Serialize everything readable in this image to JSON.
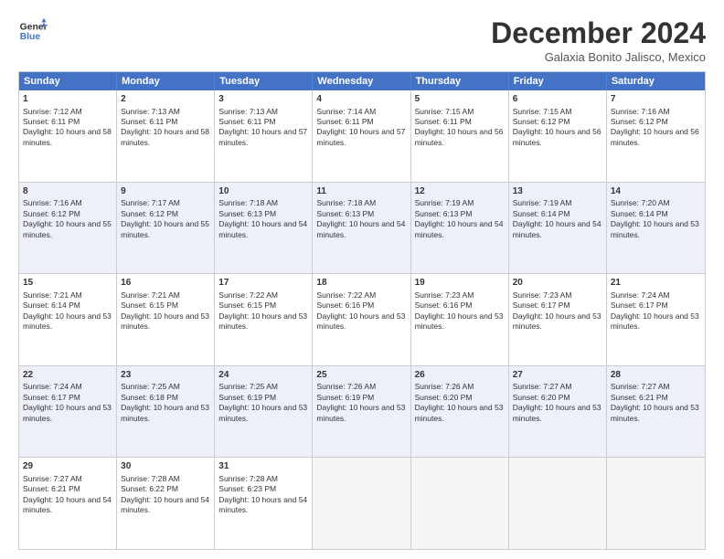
{
  "header": {
    "logo_line1": "General",
    "logo_line2": "Blue",
    "month_title": "December 2024",
    "location": "Galaxia Bonito Jalisco, Mexico"
  },
  "calendar": {
    "days_of_week": [
      "Sunday",
      "Monday",
      "Tuesday",
      "Wednesday",
      "Thursday",
      "Friday",
      "Saturday"
    ],
    "weeks": [
      [
        {
          "day": "",
          "empty": true
        },
        {
          "day": "",
          "empty": true
        },
        {
          "day": "",
          "empty": true
        },
        {
          "day": "",
          "empty": true
        },
        {
          "day": "",
          "empty": true
        },
        {
          "day": "",
          "empty": true
        },
        {
          "day": "1",
          "rise": "Sunrise: 7:16 AM",
          "set": "Sunset: 6:12 PM",
          "daylight": "Daylight: 10 hours and 56 minutes."
        }
      ],
      [
        {
          "day": "1",
          "rise": "Sunrise: 7:12 AM",
          "set": "Sunset: 6:11 PM",
          "daylight": "Daylight: 10 hours and 58 minutes."
        },
        {
          "day": "2",
          "rise": "Sunrise: 7:13 AM",
          "set": "Sunset: 6:11 PM",
          "daylight": "Daylight: 10 hours and 58 minutes."
        },
        {
          "day": "3",
          "rise": "Sunrise: 7:13 AM",
          "set": "Sunset: 6:11 PM",
          "daylight": "Daylight: 10 hours and 57 minutes."
        },
        {
          "day": "4",
          "rise": "Sunrise: 7:14 AM",
          "set": "Sunset: 6:11 PM",
          "daylight": "Daylight: 10 hours and 57 minutes."
        },
        {
          "day": "5",
          "rise": "Sunrise: 7:15 AM",
          "set": "Sunset: 6:11 PM",
          "daylight": "Daylight: 10 hours and 56 minutes."
        },
        {
          "day": "6",
          "rise": "Sunrise: 7:15 AM",
          "set": "Sunset: 6:12 PM",
          "daylight": "Daylight: 10 hours and 56 minutes."
        },
        {
          "day": "7",
          "rise": "Sunrise: 7:16 AM",
          "set": "Sunset: 6:12 PM",
          "daylight": "Daylight: 10 hours and 56 minutes."
        }
      ],
      [
        {
          "day": "8",
          "rise": "Sunrise: 7:16 AM",
          "set": "Sunset: 6:12 PM",
          "daylight": "Daylight: 10 hours and 55 minutes."
        },
        {
          "day": "9",
          "rise": "Sunrise: 7:17 AM",
          "set": "Sunset: 6:12 PM",
          "daylight": "Daylight: 10 hours and 55 minutes."
        },
        {
          "day": "10",
          "rise": "Sunrise: 7:18 AM",
          "set": "Sunset: 6:13 PM",
          "daylight": "Daylight: 10 hours and 54 minutes."
        },
        {
          "day": "11",
          "rise": "Sunrise: 7:18 AM",
          "set": "Sunset: 6:13 PM",
          "daylight": "Daylight: 10 hours and 54 minutes."
        },
        {
          "day": "12",
          "rise": "Sunrise: 7:19 AM",
          "set": "Sunset: 6:13 PM",
          "daylight": "Daylight: 10 hours and 54 minutes."
        },
        {
          "day": "13",
          "rise": "Sunrise: 7:19 AM",
          "set": "Sunset: 6:14 PM",
          "daylight": "Daylight: 10 hours and 54 minutes."
        },
        {
          "day": "14",
          "rise": "Sunrise: 7:20 AM",
          "set": "Sunset: 6:14 PM",
          "daylight": "Daylight: 10 hours and 53 minutes."
        }
      ],
      [
        {
          "day": "15",
          "rise": "Sunrise: 7:21 AM",
          "set": "Sunset: 6:14 PM",
          "daylight": "Daylight: 10 hours and 53 minutes."
        },
        {
          "day": "16",
          "rise": "Sunrise: 7:21 AM",
          "set": "Sunset: 6:15 PM",
          "daylight": "Daylight: 10 hours and 53 minutes."
        },
        {
          "day": "17",
          "rise": "Sunrise: 7:22 AM",
          "set": "Sunset: 6:15 PM",
          "daylight": "Daylight: 10 hours and 53 minutes."
        },
        {
          "day": "18",
          "rise": "Sunrise: 7:22 AM",
          "set": "Sunset: 6:16 PM",
          "daylight": "Daylight: 10 hours and 53 minutes."
        },
        {
          "day": "19",
          "rise": "Sunrise: 7:23 AM",
          "set": "Sunset: 6:16 PM",
          "daylight": "Daylight: 10 hours and 53 minutes."
        },
        {
          "day": "20",
          "rise": "Sunrise: 7:23 AM",
          "set": "Sunset: 6:17 PM",
          "daylight": "Daylight: 10 hours and 53 minutes."
        },
        {
          "day": "21",
          "rise": "Sunrise: 7:24 AM",
          "set": "Sunset: 6:17 PM",
          "daylight": "Daylight: 10 hours and 53 minutes."
        }
      ],
      [
        {
          "day": "22",
          "rise": "Sunrise: 7:24 AM",
          "set": "Sunset: 6:17 PM",
          "daylight": "Daylight: 10 hours and 53 minutes."
        },
        {
          "day": "23",
          "rise": "Sunrise: 7:25 AM",
          "set": "Sunset: 6:18 PM",
          "daylight": "Daylight: 10 hours and 53 minutes."
        },
        {
          "day": "24",
          "rise": "Sunrise: 7:25 AM",
          "set": "Sunset: 6:19 PM",
          "daylight": "Daylight: 10 hours and 53 minutes."
        },
        {
          "day": "25",
          "rise": "Sunrise: 7:26 AM",
          "set": "Sunset: 6:19 PM",
          "daylight": "Daylight: 10 hours and 53 minutes."
        },
        {
          "day": "26",
          "rise": "Sunrise: 7:26 AM",
          "set": "Sunset: 6:20 PM",
          "daylight": "Daylight: 10 hours and 53 minutes."
        },
        {
          "day": "27",
          "rise": "Sunrise: 7:27 AM",
          "set": "Sunset: 6:20 PM",
          "daylight": "Daylight: 10 hours and 53 minutes."
        },
        {
          "day": "28",
          "rise": "Sunrise: 7:27 AM",
          "set": "Sunset: 6:21 PM",
          "daylight": "Daylight: 10 hours and 53 minutes."
        }
      ],
      [
        {
          "day": "29",
          "rise": "Sunrise: 7:27 AM",
          "set": "Sunset: 6:21 PM",
          "daylight": "Daylight: 10 hours and 54 minutes."
        },
        {
          "day": "30",
          "rise": "Sunrise: 7:28 AM",
          "set": "Sunset: 6:22 PM",
          "daylight": "Daylight: 10 hours and 54 minutes."
        },
        {
          "day": "31",
          "rise": "Sunrise: 7:28 AM",
          "set": "Sunset: 6:23 PM",
          "daylight": "Daylight: 10 hours and 54 minutes."
        },
        {
          "day": "",
          "empty": true
        },
        {
          "day": "",
          "empty": true
        },
        {
          "day": "",
          "empty": true
        },
        {
          "day": "",
          "empty": true
        }
      ]
    ]
  }
}
